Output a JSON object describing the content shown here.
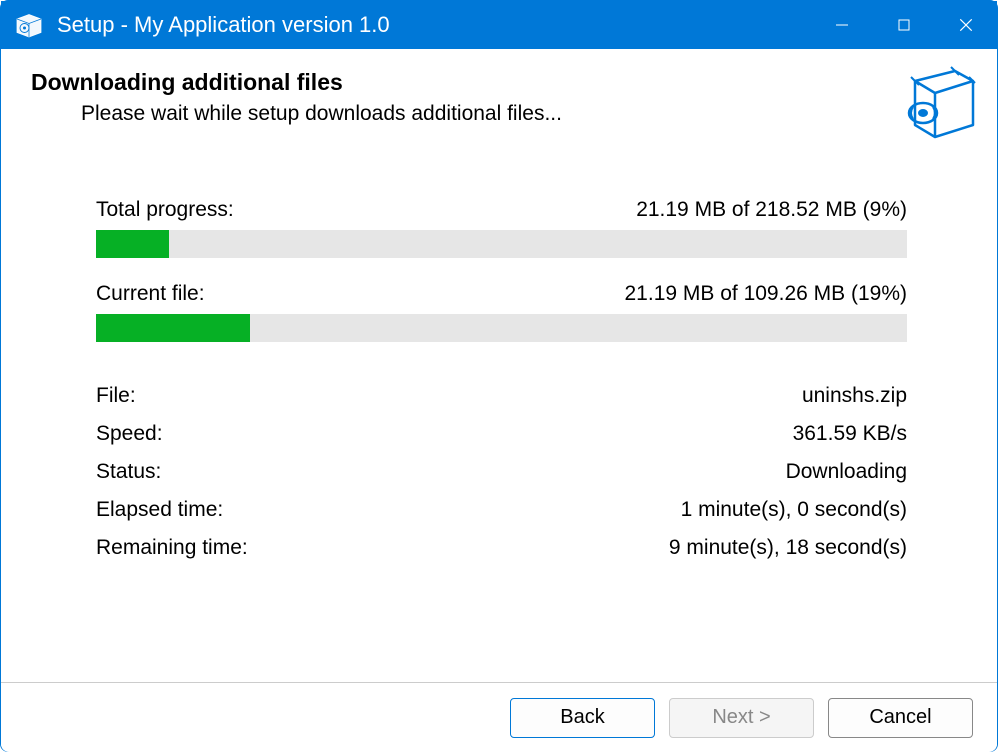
{
  "titlebar": {
    "title": "Setup - My Application version 1.0"
  },
  "header": {
    "heading": "Downloading additional files",
    "subheading": "Please wait while setup downloads additional files..."
  },
  "progress": {
    "total": {
      "label": "Total progress:",
      "value": "21.19 MB of 218.52 MB (9%)",
      "percent": 9
    },
    "current": {
      "label": "Current file:",
      "value": "21.19 MB of 109.26 MB (19%)",
      "percent": 19
    }
  },
  "info": {
    "file": {
      "label": "File:",
      "value": "uninshs.zip"
    },
    "speed": {
      "label": "Speed:",
      "value": "361.59 KB/s"
    },
    "status": {
      "label": "Status:",
      "value": "Downloading"
    },
    "elapsed": {
      "label": "Elapsed time:",
      "value": "1 minute(s), 0 second(s)"
    },
    "remaining": {
      "label": "Remaining time:",
      "value": "9 minute(s), 18 second(s)"
    }
  },
  "footer": {
    "back": "Back",
    "next": "Next >",
    "cancel": "Cancel"
  }
}
